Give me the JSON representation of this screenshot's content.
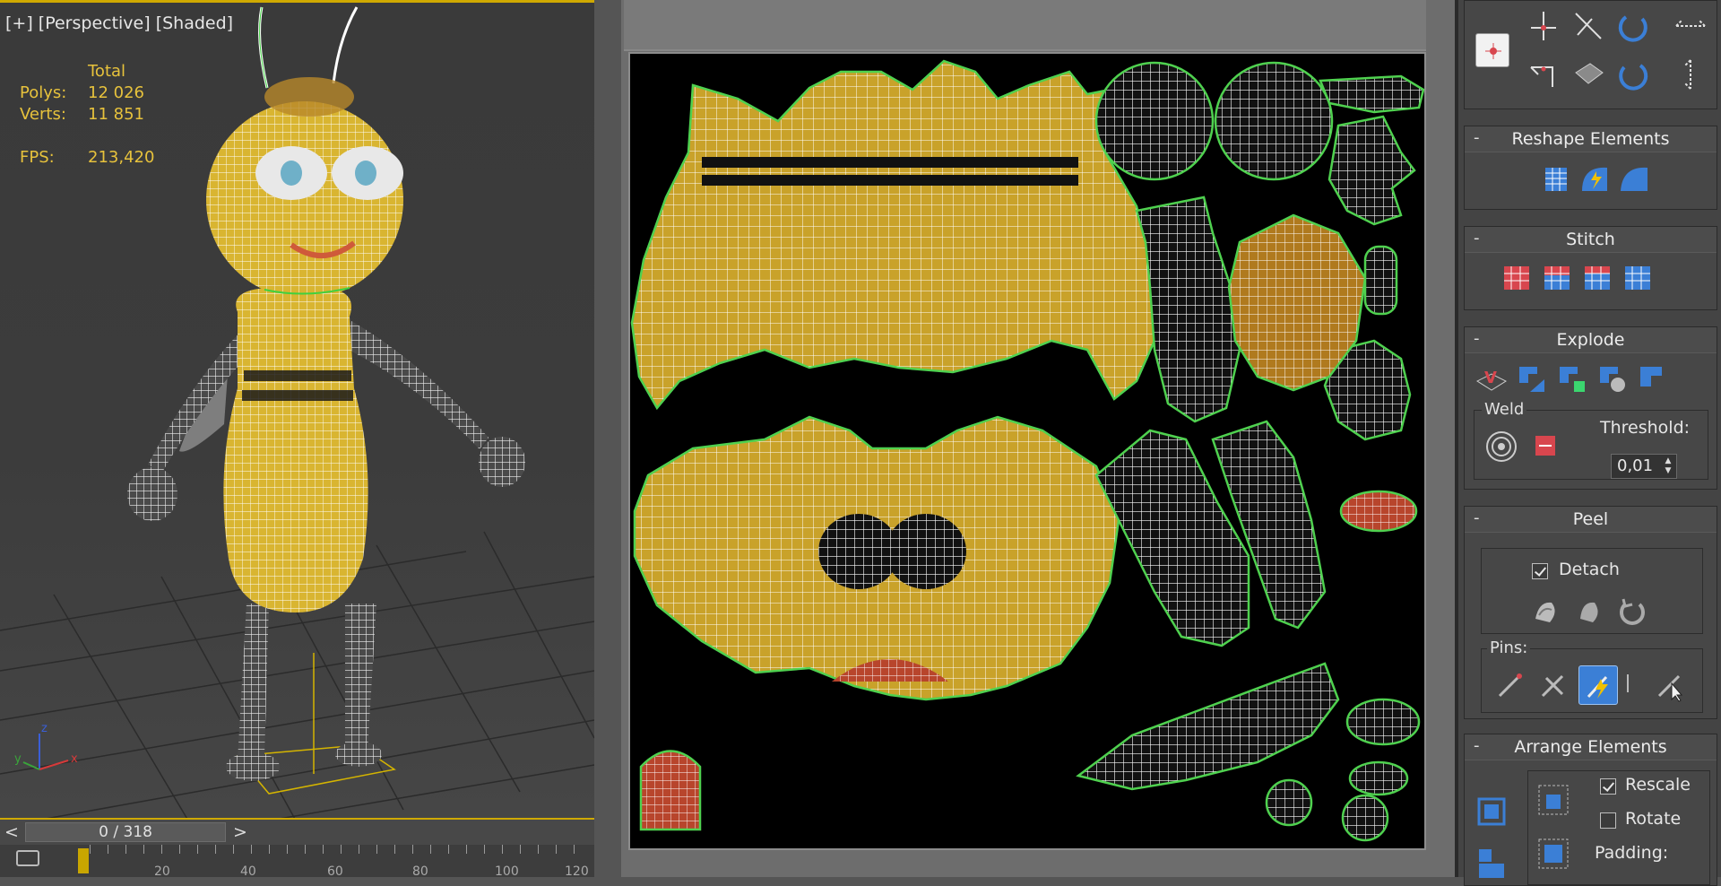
{
  "viewport": {
    "label": "[+] [Perspective] [Shaded]",
    "stats": {
      "header": "Total",
      "polys_label": "Polys:",
      "polys_value": "12 026",
      "verts_label": "Verts:",
      "verts_value": "11 851",
      "fps_label": "FPS:",
      "fps_value": "213,420"
    },
    "axis_labels": {
      "x": "x",
      "y": "y",
      "z": "z"
    }
  },
  "timeline": {
    "prev_label": "<",
    "next_label": ">",
    "frame_display": "0 / 318",
    "tick_labels": [
      "20",
      "40",
      "60",
      "80",
      "100",
      "120"
    ]
  },
  "panel": {
    "reshape_title": "Reshape Elements",
    "stitch_title": "Stitch",
    "explode_title": "Explode",
    "weld_label": "Weld",
    "threshold_label": "Threshold:",
    "threshold_value": "0,01",
    "peel_title": "Peel",
    "detach_label": "Detach",
    "detach_checked": true,
    "pins_label": "Pins:",
    "arrange_title": "Arrange Elements",
    "rescale_label": "Rescale",
    "rescale_checked": true,
    "rotate_label": "Rotate",
    "rotate_checked": false,
    "padding_label": "Padding:",
    "collapse_symbol": "-"
  },
  "colors": {
    "accent_yellow": "#cfa900",
    "stats_text": "#e7c23c",
    "uv_fill": "#c9a22a",
    "uv_edge": "#4fd14f",
    "icon_blue": "#3b7fd6",
    "icon_red": "#d8464e"
  }
}
